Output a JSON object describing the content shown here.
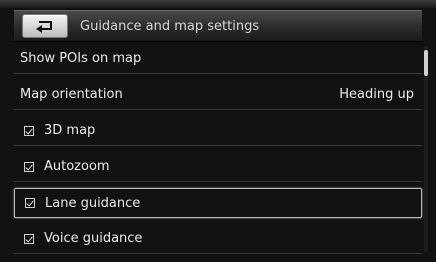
{
  "header": {
    "title": "Guidance and map settings",
    "back_icon": "return-arrow-icon"
  },
  "items": [
    {
      "label": "Show POIs on map",
      "type": "menu"
    },
    {
      "label": "Map orientation",
      "type": "option",
      "value": "Heading up"
    },
    {
      "label": "3D map",
      "type": "checkbox",
      "checked": true
    },
    {
      "label": "Autozoom",
      "type": "checkbox",
      "checked": true
    },
    {
      "label": "Lane guidance",
      "type": "checkbox",
      "checked": true,
      "selected": true
    },
    {
      "label": "Voice guidance",
      "type": "checkbox",
      "checked": true
    }
  ],
  "scroll": {
    "position": 0.0
  }
}
